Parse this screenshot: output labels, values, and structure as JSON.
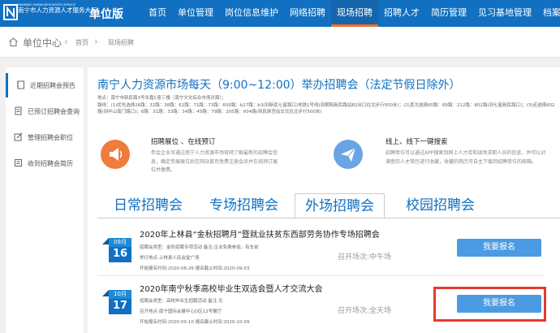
{
  "header": {
    "logo_text_en": "NANNING HUMAN RESOURCES SERVICE",
    "logo_text_cn": "南宁市人力资源人才服务大厅",
    "unit_label": "单位版",
    "nav": [
      "首页",
      "单位管理",
      "岗位信息维护",
      "网络招聘",
      "现场招聘",
      "招聘人才",
      "简历管理",
      "见习基地管理",
      "档案服务"
    ],
    "active_nav_index": 4
  },
  "breadcrumb": {
    "title": "单位中心",
    "items": [
      "首页",
      "现场招聘"
    ]
  },
  "sidebar": {
    "items": [
      {
        "label": "近期招聘会预告",
        "icon": "notebook-icon"
      },
      {
        "label": "已预订招聘会查询",
        "icon": "document-icon"
      },
      {
        "label": "管理招聘会职位",
        "icon": "edit-icon"
      },
      {
        "label": "收到招聘会简历",
        "icon": "list-icon"
      }
    ]
  },
  "main": {
    "headline": "南宁人力资源市场每天（9:00~12:00）举办招聘会（法定节假日除外）",
    "address": "地点：南宁市新民路3号永嘉C座三楼（南宁文化综合市场对面）；",
    "routes": "路线：(1)优先选择26路：32路：38路：62路：71路：73路：609路：b27路：b3(到新民七星路口)地铁1号线(到朝阳新民路站B2出口往北步行500米)；(2)其次选择80路：89路：212路：802路(到七星新民路口)；(3)还选择802路(到中山南门路口)；6路：31路：33路：34路：45路：79路：205路：604路(到民族宫站交北往北步行500米)",
    "features": [
      {
        "title": "招聘展位 、在线预订",
        "desc": "参会企业可通过南宁人力资源市场官网了解最新的招聘会信息，确定参展展位后在网站首页免费注册会员并在线预订展位并缴费。",
        "icon": "megaphone-icon"
      },
      {
        "title": "线上、线下一键搜索",
        "desc": "招聘单位可以通过APP搜索到网上人才库和现场求职人员的信息，并可以对满意的人才简历进行收藏，收藏的简历可自主下载到招聘单位的邮箱。",
        "icon": "paper-plane-icon"
      }
    ],
    "tabs": [
      "日常招聘会",
      "专场招聘会",
      "外场招聘会",
      "校园招聘会"
    ],
    "active_tab_index": 2,
    "fairs": [
      {
        "month": "09月",
        "day": "16",
        "title": "2020年上林县“金秋招聘月”暨就业扶贫东西部劳务协作专场招聘会",
        "type_line": "招聘会类型：金秋招聘专项活动   备注:企业免费参加，有车前",
        "place_line": "举行地点:上林县人民会堂广场",
        "date_line": "开始报名时间:2020-08-26   报名截止时间:2020-09-03",
        "status": "召开场次:中午场",
        "button": "我要报名"
      },
      {
        "month": "10月",
        "day": "17",
        "title": "2020年南宁秋季高校毕业生双选会暨人才交流大会",
        "type_line": "招聘会类型：高校毕业生招聘活动   备注:无",
        "place_line": "召开地点:南宁国际会展中心D区12号展厅",
        "date_line": "开始报名时间:2020-09-10   报名截止时间:2020-10-09",
        "status": "召开场次:全天场",
        "button": "我要报名"
      }
    ]
  },
  "colors": {
    "brand": "#1170c1",
    "accent_button": "#4b9be2",
    "highlight": "#e43a2f",
    "nav_active_underline": "#f36d2b"
  }
}
